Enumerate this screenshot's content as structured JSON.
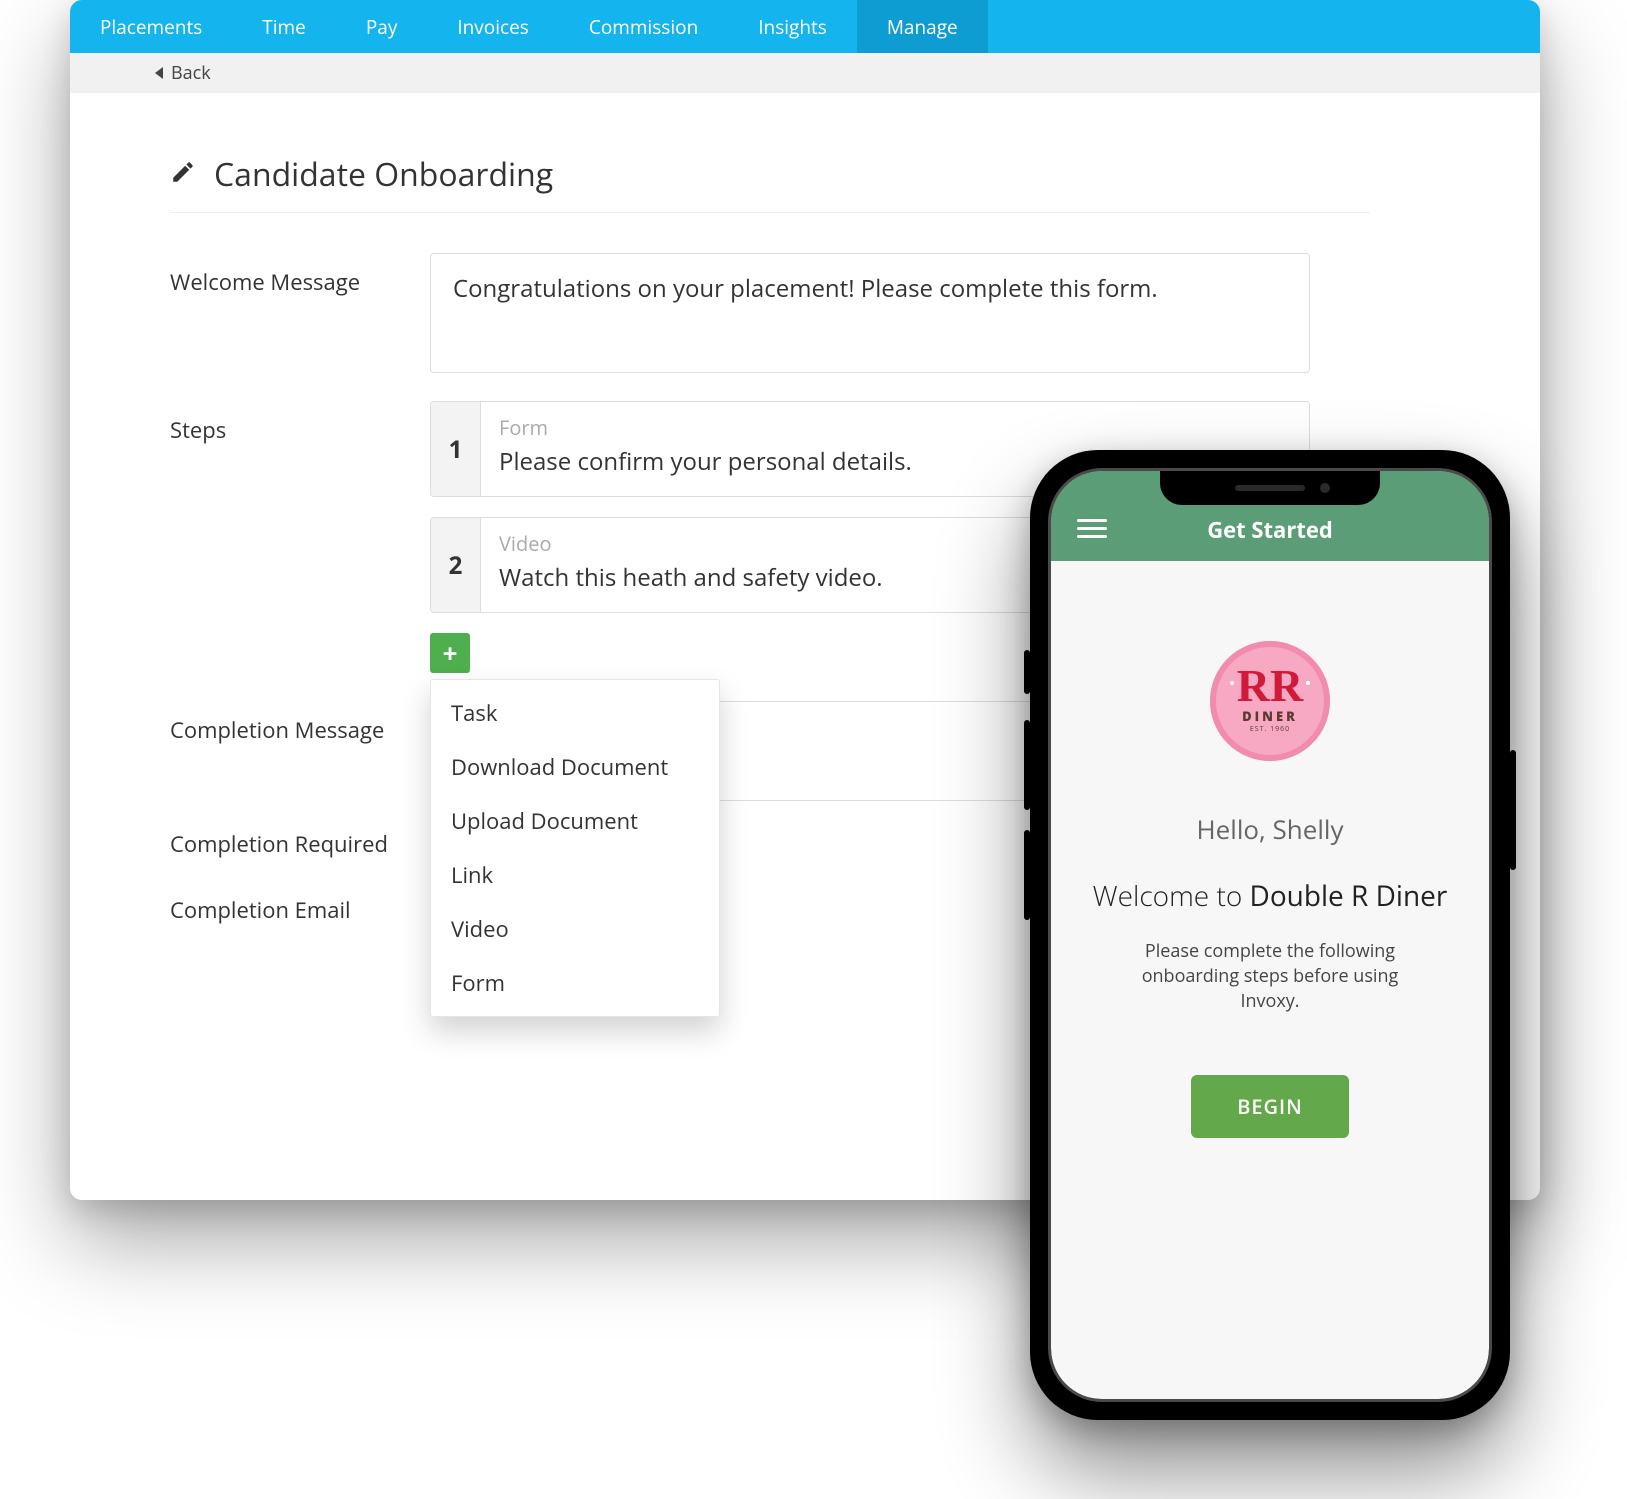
{
  "nav": {
    "items": [
      "Placements",
      "Time",
      "Pay",
      "Invoices",
      "Commission",
      "Insights",
      "Manage"
    ],
    "active_index": 6
  },
  "subbar": {
    "back_label": "Back"
  },
  "page": {
    "title": "Candidate Onboarding"
  },
  "fields": {
    "welcome_label": "Welcome Message",
    "welcome_value": "Congratulations on your placement! Please complete this form.",
    "steps_label": "Steps",
    "completion_message_label": "Completion Message",
    "completion_required_label": "Completion Required",
    "completion_email_label": "Completion Email"
  },
  "steps": [
    {
      "num": "1",
      "type": "Form",
      "text": "Please confirm your personal details."
    },
    {
      "num": "2",
      "type": "Video",
      "text": "Watch this heath and safety video."
    }
  ],
  "add_menu": {
    "plus": "+",
    "items": [
      "Task",
      "Download Document",
      "Upload Document",
      "Link",
      "Video",
      "Form"
    ]
  },
  "phone": {
    "header_title": "Get Started",
    "logo": {
      "rr": "RR",
      "diner": "DINER",
      "est": "EST. 1960"
    },
    "hello": "Hello, Shelly",
    "welcome_light": "Welcome to ",
    "welcome_bold": "Double R Diner",
    "instruction": "Please complete the following onboarding steps before using Invoxy.",
    "begin_label": "BEGIN"
  }
}
